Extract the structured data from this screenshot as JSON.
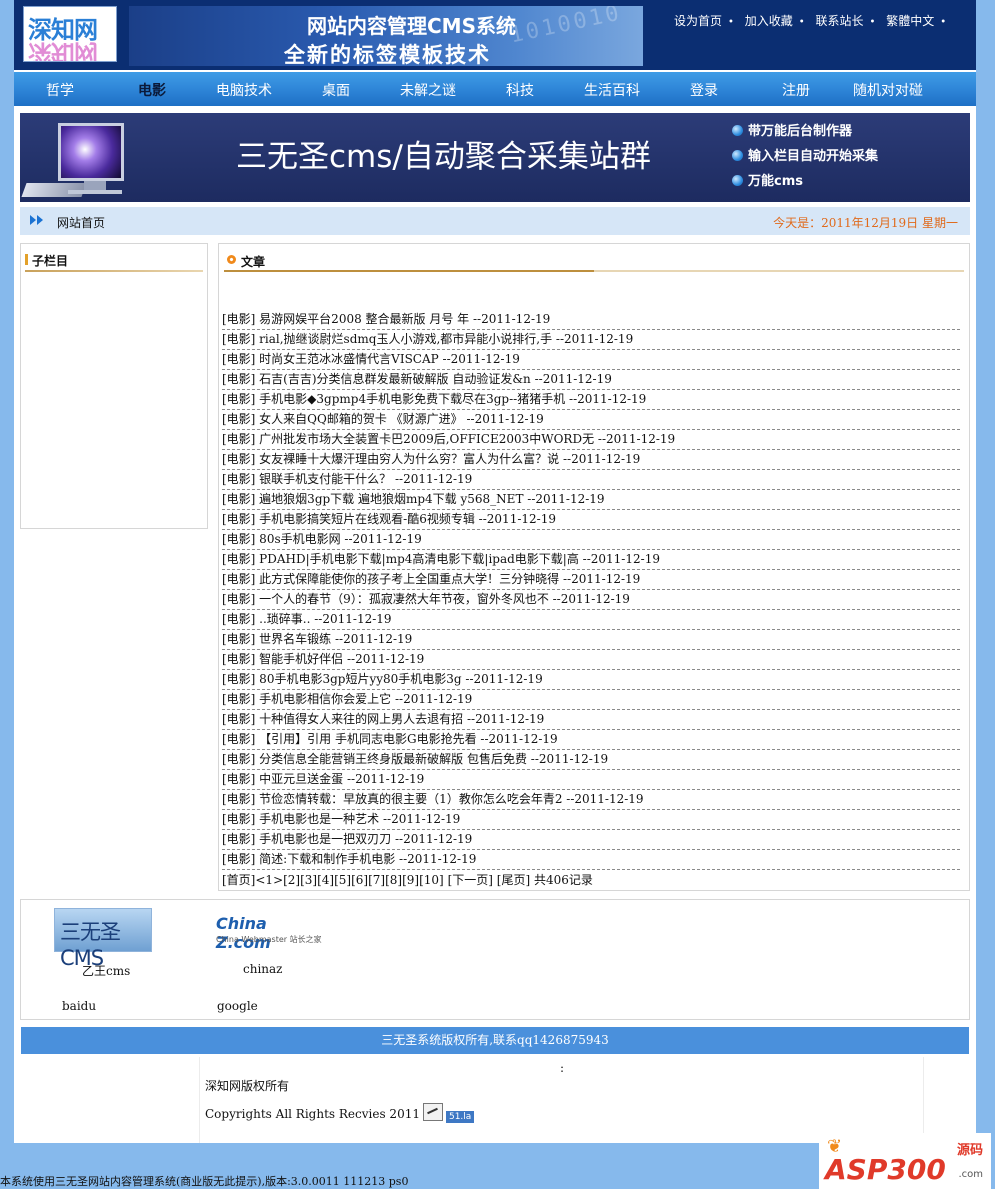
{
  "header": {
    "logo_text": "深知网",
    "banner_title": "网站内容管理CMS系统",
    "banner_slogan": "全新的标签模板技术",
    "banner_deco": "1010010",
    "top_links": [
      "设为首页",
      "加入收藏",
      "联系站长",
      "繁體中文"
    ]
  },
  "nav": {
    "items": [
      "哲学",
      "电影",
      "电脑技术",
      "桌面",
      "未解之谜",
      "科技",
      "生活百科",
      "登录",
      "注册",
      "随机对对碰"
    ],
    "active_index": 1
  },
  "ad_banner": {
    "headline": "三无圣cms/自动聚合采集站群",
    "features": [
      "带万能后台制作器",
      "输入栏目自动开始采集",
      "万能cms"
    ]
  },
  "breadcrumb": {
    "home": "网站首页",
    "date_label": "今天是：",
    "date_value": "2011年12月19日  星期一"
  },
  "sidebar": {
    "title": "子栏目"
  },
  "content": {
    "title": "文章",
    "articles": [
      "[电影] 易游网娱平台2008 整合最新版 月号 年  --2011-12-19",
      "[电影] rial,抛继谈尉烂sdmq玉人小游戏,都市异能小说排行,手  --2011-12-19",
      "[电影] 时尚女王范冰冰盛情代言VISCAP --2011-12-19",
      "[电影] 石吉(吉吉)分类信息群发最新破解版 自动验证发&n --2011-12-19",
      "[电影] 手机电影◆3gpmp4手机电影免费下载尽在3gp--猪猪手机  --2011-12-19",
      "[电影] 女人来自QQ邮箱的贺卡 《财源广进》  --2011-12-19",
      "[电影] 广州批发市场大全装置卡巴2009后,OFFICE2003中WORD无  --2011-12-19",
      "[电影] 女友裸睡十大爆汗理由穷人为什么穷？富人为什么富？说  --2011-12-19",
      "[电影] 银联手机支付能干什么？  --2011-12-19",
      "[电影] 遍地狼烟3gp下载 遍地狼烟mp4下载 y568_NET --2011-12-19",
      "[电影] 手机电影搞笑短片在线观看-酷6视频专辑  --2011-12-19",
      "[电影] 80s手机电影网  --2011-12-19",
      "[电影] PDAHD|手机电影下载|mp4高清电影下载|ipad电影下载|高  --2011-12-19",
      "[电影] 此方式保障能使你的孩子考上全国重点大学！三分钟晓得  --2011-12-19",
      "[电影] 一个人的春节（9）：孤寂凄然大年节夜，窗外冬风也不  --2011-12-19",
      "[电影] ..琐碎事.. --2011-12-19",
      "[电影] 世界名车锻练  --2011-12-19",
      "[电影] 智能手机好伴侣  --2011-12-19",
      "[电影] 80手机电影3gp短片yy80手机电影3g --2011-12-19",
      "[电影] 手机电影相信你会爱上它  --2011-12-19",
      "[电影] 十种值得女人来往的网上男人去退有招  --2011-12-19",
      "[电影] 【引用】引用 手机同志电影G电影抢先看  --2011-12-19",
      "[电影] 分类信息全能营销王终身版最新破解版 包售后免费  --2011-12-19",
      "[电影] 中亚元旦送金蛋  --2011-12-19",
      "[电影] 节俭恋情转载：早放真的很主要（1）教你怎么吃会年青2 --2011-12-19",
      "[电影] 手机电影也是一种艺术  --2011-12-19",
      "[电影] 手机电影也是一把双刃刀  --2011-12-19",
      "[电影] 简述:下载和制作手机电影  --2011-12-19"
    ],
    "pager": {
      "first": "[首页]",
      "pages": "<1>[2][3][4][5][6][7][8][9][10]",
      "next": "[下一页]",
      "last": "[尾页]",
      "total": "共406记录"
    }
  },
  "friend_links": {
    "logo1_text": "三无圣CMS",
    "logo2_text": "China Z.com",
    "logo2_sub": "China Webmaster 站长之家",
    "names": [
      "乙王cms",
      "chinaz",
      "baidu",
      "google"
    ]
  },
  "footer": {
    "copyright_bar": "三无圣系统版权所有,联系qq1426875943",
    "colon": ":",
    "line1": "深知网版权所有",
    "line2": "Copyrights All Rights Recvies 2011",
    "stat_badge": "51.la",
    "system_line": "本系统使用三无圣网站内容管理系统(商业版无此提示),版本:3.0.0011 111213 ps0",
    "corner_logo": "ASP300",
    "corner_tag": "源码",
    "corner_domain": ".com"
  }
}
